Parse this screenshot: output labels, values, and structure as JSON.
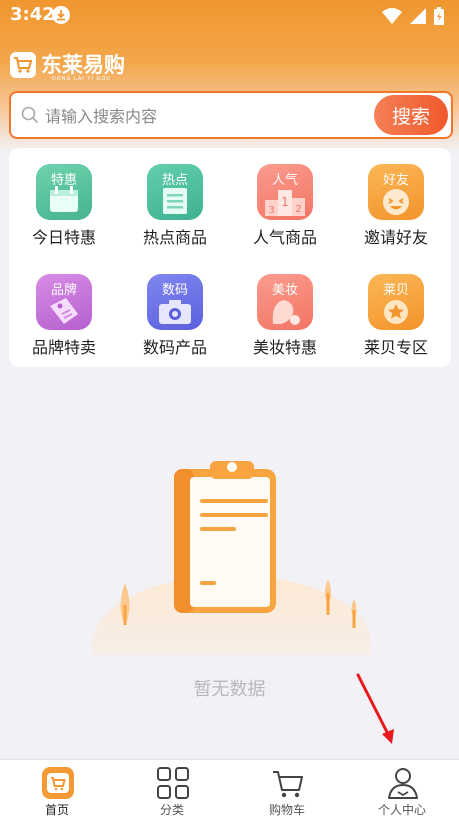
{
  "status": {
    "time": "3:42"
  },
  "brand": {
    "name": "东莱易购",
    "subtitle": "DONG LAI YI GOU"
  },
  "search": {
    "placeholder": "请输入搜索内容",
    "button_label": "搜索"
  },
  "categories": [
    {
      "tag": "特惠",
      "label": "今日特惠",
      "icon": "calendar-icon",
      "color": "#5ec5a0"
    },
    {
      "tag": "热点",
      "label": "热点商品",
      "icon": "document-icon",
      "color": "#52c2a4"
    },
    {
      "tag": "人气",
      "label": "人气商品",
      "icon": "podium-icon",
      "color": "#f7867a"
    },
    {
      "tag": "好友",
      "label": "邀请好友",
      "icon": "smile-icon",
      "color": "#f7a540"
    },
    {
      "tag": "品牌",
      "label": "品牌特卖",
      "icon": "price-tag-icon",
      "color": "#c679d9"
    },
    {
      "tag": "数码",
      "label": "数码产品",
      "icon": "camera-icon",
      "color": "#6e72e6"
    },
    {
      "tag": "美妆",
      "label": "美妆特惠",
      "icon": "cosmetics-icon",
      "color": "#f6897b"
    },
    {
      "tag": "莱贝",
      "label": "莱贝专区",
      "icon": "medal-icon",
      "color": "#f6a53c"
    }
  ],
  "empty_state": {
    "text": "暂无数据",
    "icon": "clipboard-icon"
  },
  "tabs": [
    {
      "label": "首页",
      "icon": "home-cart-icon",
      "active": true
    },
    {
      "label": "分类",
      "icon": "grid-icon",
      "active": false
    },
    {
      "label": "购物车",
      "icon": "shopping-cart-icon",
      "active": false
    },
    {
      "label": "个人中心",
      "icon": "user-icon",
      "active": false
    }
  ],
  "colors": {
    "accent": "#f1782b",
    "header": "#f0962e",
    "annotation_arrow": "#e8191d"
  }
}
